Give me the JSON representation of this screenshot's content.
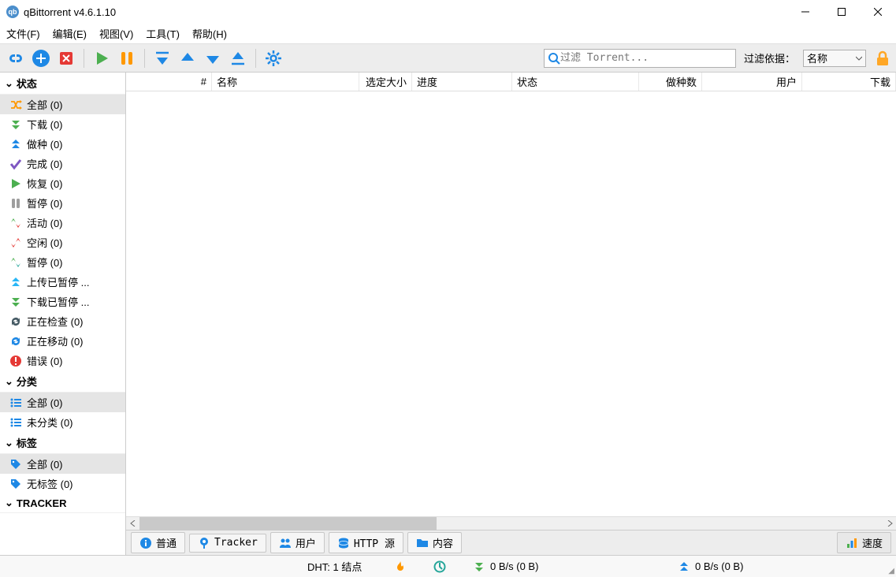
{
  "window": {
    "title": "qBittorrent v4.6.1.10"
  },
  "menu": {
    "file": "文件(F)",
    "edit": "编辑(E)",
    "view": "视图(V)",
    "tools": "工具(T)",
    "help": "帮助(H)"
  },
  "filter": {
    "placeholder": "过滤 Torrent...",
    "label": "过滤依据：",
    "combo": "名称"
  },
  "sidebar": {
    "status": {
      "header": "状态",
      "items": [
        {
          "label": "全部 (0)"
        },
        {
          "label": "下载 (0)"
        },
        {
          "label": "做种 (0)"
        },
        {
          "label": "完成 (0)"
        },
        {
          "label": "恢复 (0)"
        },
        {
          "label": "暂停 (0)"
        },
        {
          "label": "活动 (0)"
        },
        {
          "label": "空闲 (0)"
        },
        {
          "label": "暂停 (0)"
        },
        {
          "label": "上传已暂停 ..."
        },
        {
          "label": "下载已暂停 ..."
        },
        {
          "label": "正在检查 (0)"
        },
        {
          "label": "正在移动 (0)"
        },
        {
          "label": "错误 (0)"
        }
      ]
    },
    "category": {
      "header": "分类",
      "items": [
        {
          "label": "全部 (0)"
        },
        {
          "label": "未分类 (0)"
        }
      ]
    },
    "tags": {
      "header": "标签",
      "items": [
        {
          "label": "全部 (0)"
        },
        {
          "label": "无标签 (0)"
        }
      ]
    },
    "tracker": {
      "header": "TRACKER"
    }
  },
  "columns": {
    "num": "#",
    "name": "名称",
    "size": "选定大小",
    "progress": "进度",
    "status": "状态",
    "seeds": "做种数",
    "peers": "用户",
    "down": "下载"
  },
  "tabs": {
    "general": "普通",
    "tracker": "Tracker",
    "peers": "用户",
    "http": "HTTP 源",
    "content": "内容",
    "speed": "速度"
  },
  "status": {
    "dht": "DHT: 1 结点",
    "dl": "0 B/s (0 B)",
    "ul": "0 B/s (0 B)"
  }
}
